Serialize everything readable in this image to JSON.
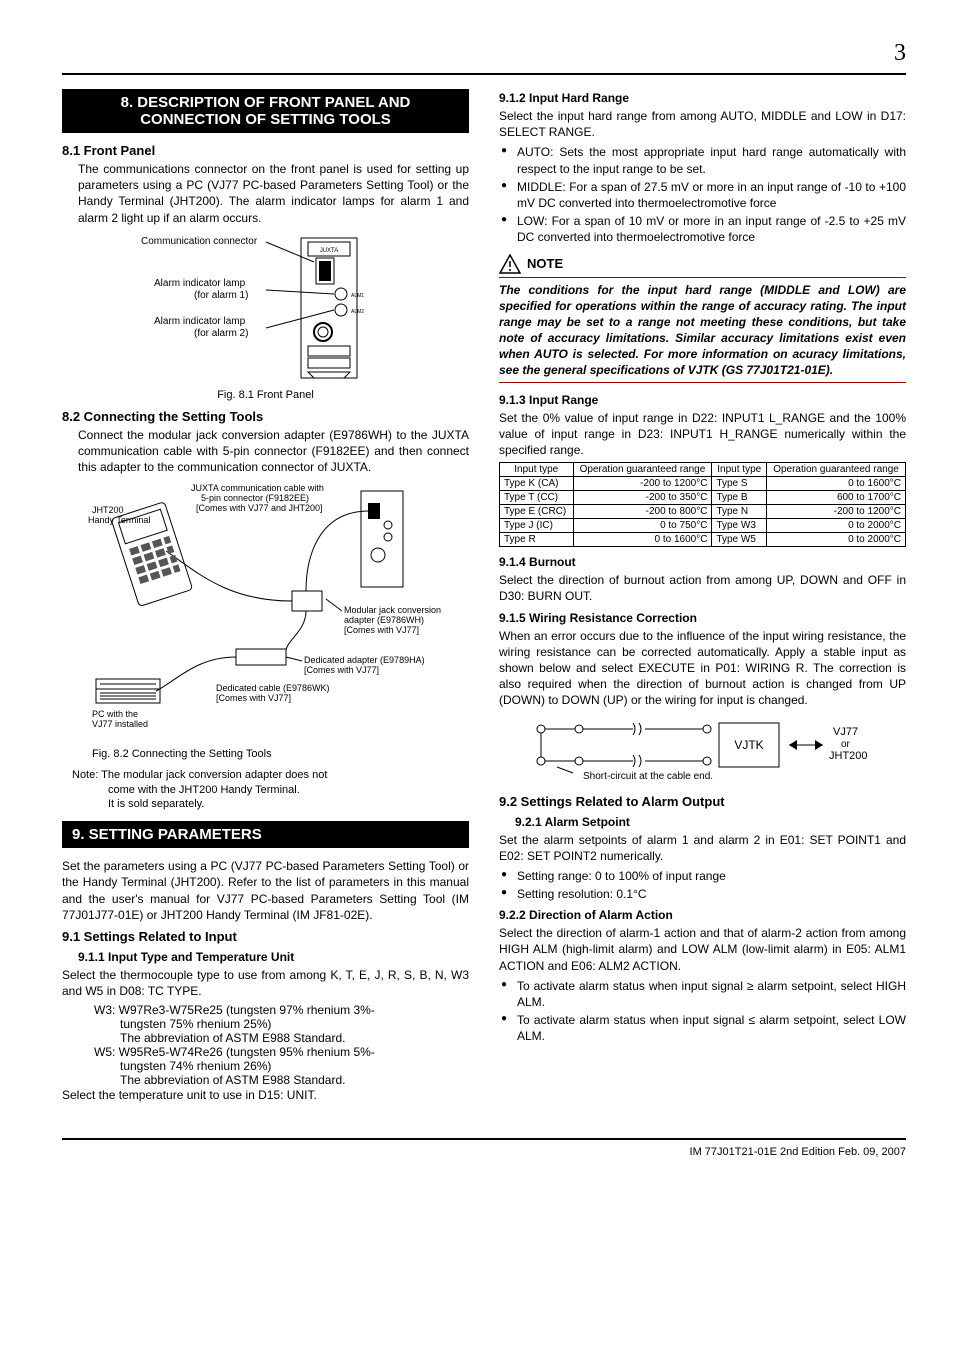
{
  "page_number": "3",
  "left": {
    "banner8": "8. DESCRIPTION OF FRONT PANEL AND CONNECTION OF SETTING TOOLS",
    "h81": "8.1   Front Panel",
    "p81": "The communications connector on the front panel is used for setting up parameters using a PC (VJ77 PC-based Parameters Setting Tool) or the Handy Terminal (JHT200). The alarm indicator lamps for alarm 1 and alarm 2 light up if an alarm occurs.",
    "fig81_cap": "Fig. 8.1   Front Panel",
    "fig81_labels": {
      "comm": "Communication connector",
      "alm1a": "Alarm indicator lamp",
      "alm1b": "(for alarm 1)",
      "alm2a": "Alarm indicator lamp",
      "alm2b": "(for alarm 2)",
      "brand": "JUXTA",
      "alm1_tag": "ALM1",
      "alm2_tag": "ALM2"
    },
    "h82": "8.2   Connecting the Setting Tools",
    "p82": "Connect the modular jack conversion adapter (E9786WH) to the JUXTA communication cable with 5-pin connector (F9182EE) and then connect this adapter to the communication connector of JUXTA.",
    "fig82_cap": "Fig. 8.2   Connecting the Setting Tools",
    "fig82_labels": {
      "cable_a": "JUXTA communication cable with",
      "cable_b": "5-pin connector (F9182EE)",
      "cable_c": "[Comes with VJ77 and JHT200]",
      "jht_a": "JHT200",
      "jht_b": "Handy Terminal",
      "modjack_a": "Modular jack conversion",
      "modjack_b": "adapter (E9786WH)",
      "modjack_c": "[Comes with VJ77]",
      "dadapt_a": "Dedicated adapter (E9789HA)",
      "dadapt_b": "[Comes with VJ77]",
      "dcable_a": "Dedicated cable (E9786WK)",
      "dcable_b": "[Comes with VJ77]",
      "pc_a": "PC with the",
      "pc_b": "VJ77 installed"
    },
    "note82_a": "Note:  The modular jack conversion adapter does not",
    "note82_b": "come with the JHT200 Handy Terminal.",
    "note82_c": "It is sold separately.",
    "banner9": "9. SETTING PARAMETERS",
    "p9": "Set the parameters using a PC (VJ77 PC-based Parameters Setting Tool) or the Handy Terminal (JHT200).  Refer to the list of parameters in this manual and the user's manual for VJ77 PC-based Parameters Setting Tool (IM 77J01J77-01E) or JHT200 Handy Terminal (IM JF81-02E).",
    "h91": "9.1   Settings Related to Input",
    "h911": "9.1.1   Input Type and Temperature Unit",
    "p911a": "Select the thermocouple type to use from among K, T, E, J, R, S, B, N, W3 and W5 in D08: TC TYPE.",
    "p911_w3a": "W3: W97Re3-W75Re25 (tungsten 97% rhenium 3%-",
    "p911_w3b": "tungsten 75% rhenium 25%)",
    "p911_w3c": "The abbreviation of ASTM E988 Standard.",
    "p911_w5a": "W5: W95Re5-W74Re26 (tungsten 95% rhenium 5%-",
    "p911_w5b": "tungsten 74% rhenium 26%)",
    "p911_w5c": "The abbreviation of ASTM E988 Standard.",
    "p911b": "Select the temperature unit to use in D15: UNIT."
  },
  "right": {
    "h912": "9.1.2   Input Hard Range",
    "p912": "Select the input hard range from among AUTO, MIDDLE and LOW in D17: SELECT RANGE.",
    "b912": [
      "AUTO: Sets the most appropriate input hard range automatically with respect to the input range to be set.",
      "MIDDLE: For a span of 27.5 mV or more in an input range of -10 to +100 mV DC converted into thermoelectromotive force",
      "LOW: For a span of 10 mV or more in an input range of -2.5 to +25 mV DC converted into thermoelectromotive force"
    ],
    "note_title": "NOTE",
    "note_body": "The conditions for the input hard range (MIDDLE and LOW) are specified for operations within the range of accuracy rating.  The input range may be set to a range not meeting these conditions, but take note of accuracy limitations.  Similar accuracy limitations exist even when AUTO is selected.  For more information on acuracy limitations, see the general specifications of VJTK (GS 77J01T21-01E).",
    "h913": "9.1.3   Input Range",
    "p913": "Set the 0% value of input range in D22: INPUT1 L_RANGE and the 100% value of input range in D23: INPUT1 H_RANGE numerically within the specified range.",
    "table": {
      "headers": [
        "Input type",
        "Operation guaranteed range",
        "Input type",
        "Operation guaranteed range"
      ],
      "rows": [
        [
          "Type K (CA)",
          "-200  to  1200°C",
          "Type S",
          "0  to  1600°C"
        ],
        [
          "Type T (CC)",
          "-200  to    350°C",
          "Type B",
          "600  to  1700°C"
        ],
        [
          "Type E (CRC)",
          "-200  to    800°C",
          "Type N",
          "-200  to  1200°C"
        ],
        [
          "Type J (IC)",
          "0  to    750°C",
          "Type W3",
          "0  to  2000°C"
        ],
        [
          "Type R",
          "0  to  1600°C",
          "Type W5",
          "0  to  2000°C"
        ]
      ]
    },
    "h914": "9.1.4   Burnout",
    "p914": "Select the direction of burnout action from among UP, DOWN and OFF in D30: BURN OUT.",
    "h915": "9.1.5   Wiring Resistance Correction",
    "p915": "When an error occurs due to the influence of the input wiring resistance, the wiring resistance can be corrected automatically.  Apply a stable input as shown below and select EXECUTE in P01: WIRING R.  The correction is also required when the direction of burnout action is changed from UP (DOWN) to DOWN (UP) or the wiring for input is changed.",
    "fig915_labels": {
      "vjtk": "VJTK",
      "vj77": "VJ77",
      "or": "or",
      "jht": "JHT200",
      "short": "Short-circuit at the cable end."
    },
    "h92": "9.2   Settings Related to Alarm Output",
    "h921": "9.2.1   Alarm Setpoint",
    "p921": "Set the alarm setpoints of alarm 1 and alarm 2 in E01: SET POINT1 and E02: SET POINT2 numerically.",
    "b921": [
      "Setting range: 0 to 100% of input range",
      "Setting resolution: 0.1°C"
    ],
    "h922": "9.2.2   Direction of Alarm Action",
    "p922": "Select the direction of alarm-1 action and that of alarm-2 action from among HIGH ALM (high-limit alarm) and LOW ALM (low-limit alarm) in E05: ALM1 ACTION and E06: ALM2 ACTION.",
    "b922": [
      "To activate alarm status when input signal ≥ alarm setpoint, select HIGH ALM.",
      "To activate alarm status when input signal ≤ alarm setpoint, select LOW ALM."
    ]
  },
  "footer": "IM 77J01T21-01E      2nd Edition   Feb. 09, 2007"
}
